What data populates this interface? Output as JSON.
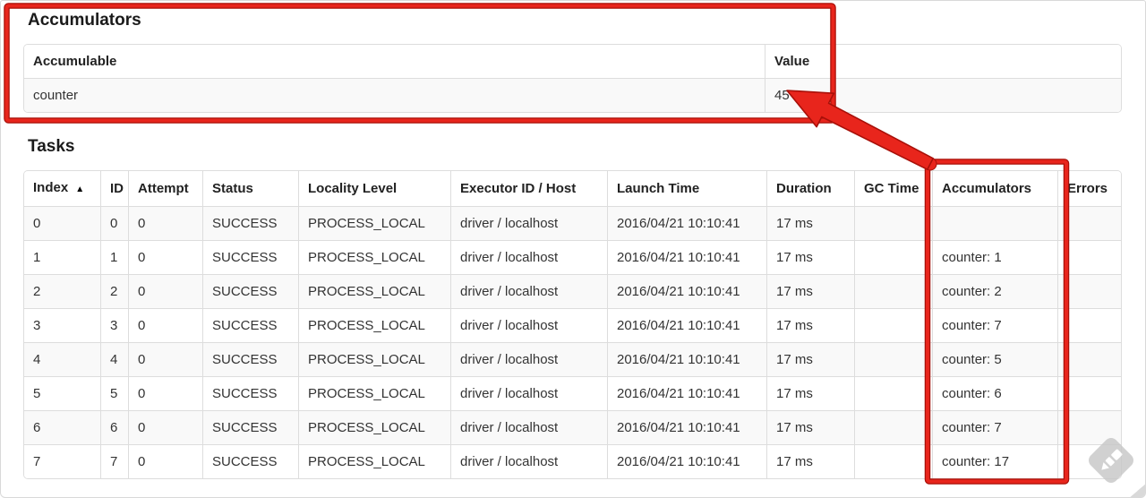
{
  "accumulators_section": {
    "title": "Accumulators",
    "table": {
      "columns": [
        {
          "label": "Accumulable"
        },
        {
          "label": "Value"
        }
      ],
      "row_keys": [
        "accumulable",
        "value"
      ],
      "rows": [
        {
          "accumulable": "counter",
          "value": "45"
        }
      ]
    }
  },
  "tasks_section": {
    "title": "Tasks",
    "table": {
      "columns": [
        {
          "label": "Index",
          "sort_indicator": "▲"
        },
        {
          "label": "ID"
        },
        {
          "label": "Attempt"
        },
        {
          "label": "Status"
        },
        {
          "label": "Locality Level"
        },
        {
          "label": "Executor ID / Host"
        },
        {
          "label": "Launch Time"
        },
        {
          "label": "Duration"
        },
        {
          "label": "GC Time"
        },
        {
          "label": "Accumulators"
        },
        {
          "label": "Errors"
        }
      ],
      "row_keys": [
        "index",
        "id",
        "attempt",
        "status",
        "locality_level",
        "executor_id_host",
        "launch_time",
        "duration",
        "gc_time",
        "accumulators",
        "errors"
      ],
      "rows": [
        {
          "index": "0",
          "id": "0",
          "attempt": "0",
          "status": "SUCCESS",
          "locality_level": "PROCESS_LOCAL",
          "executor_id_host": "driver / localhost",
          "launch_time": "2016/04/21 10:10:41",
          "duration": "17 ms",
          "gc_time": "",
          "accumulators": "",
          "errors": ""
        },
        {
          "index": "1",
          "id": "1",
          "attempt": "0",
          "status": "SUCCESS",
          "locality_level": "PROCESS_LOCAL",
          "executor_id_host": "driver / localhost",
          "launch_time": "2016/04/21 10:10:41",
          "duration": "17 ms",
          "gc_time": "",
          "accumulators": "counter: 1",
          "errors": ""
        },
        {
          "index": "2",
          "id": "2",
          "attempt": "0",
          "status": "SUCCESS",
          "locality_level": "PROCESS_LOCAL",
          "executor_id_host": "driver / localhost",
          "launch_time": "2016/04/21 10:10:41",
          "duration": "17 ms",
          "gc_time": "",
          "accumulators": "counter: 2",
          "errors": ""
        },
        {
          "index": "3",
          "id": "3",
          "attempt": "0",
          "status": "SUCCESS",
          "locality_level": "PROCESS_LOCAL",
          "executor_id_host": "driver / localhost",
          "launch_time": "2016/04/21 10:10:41",
          "duration": "17 ms",
          "gc_time": "",
          "accumulators": "counter: 7",
          "errors": ""
        },
        {
          "index": "4",
          "id": "4",
          "attempt": "0",
          "status": "SUCCESS",
          "locality_level": "PROCESS_LOCAL",
          "executor_id_host": "driver / localhost",
          "launch_time": "2016/04/21 10:10:41",
          "duration": "17 ms",
          "gc_time": "",
          "accumulators": "counter: 5",
          "errors": ""
        },
        {
          "index": "5",
          "id": "5",
          "attempt": "0",
          "status": "SUCCESS",
          "locality_level": "PROCESS_LOCAL",
          "executor_id_host": "driver / localhost",
          "launch_time": "2016/04/21 10:10:41",
          "duration": "17 ms",
          "gc_time": "",
          "accumulators": "counter: 6",
          "errors": ""
        },
        {
          "index": "6",
          "id": "6",
          "attempt": "0",
          "status": "SUCCESS",
          "locality_level": "PROCESS_LOCAL",
          "executor_id_host": "driver / localhost",
          "launch_time": "2016/04/21 10:10:41",
          "duration": "17 ms",
          "gc_time": "",
          "accumulators": "counter: 7",
          "errors": ""
        },
        {
          "index": "7",
          "id": "7",
          "attempt": "0",
          "status": "SUCCESS",
          "locality_level": "PROCESS_LOCAL",
          "executor_id_host": "driver / localhost",
          "launch_time": "2016/04/21 10:10:41",
          "duration": "17 ms",
          "gc_time": "",
          "accumulators": "counter: 17",
          "errors": ""
        }
      ]
    }
  },
  "annotations": {
    "red": "#e8251c",
    "red_dark": "#a81009",
    "watermark_gray": "#c9c9c9"
  }
}
